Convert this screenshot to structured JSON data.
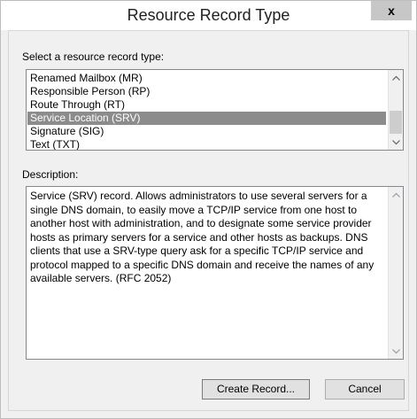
{
  "window": {
    "title": "Resource Record Type",
    "close_glyph": "x"
  },
  "record_list": {
    "label": "Select a resource record type:",
    "items": [
      {
        "label": "Renamed Mailbox (MR)",
        "selected": false
      },
      {
        "label": "Responsible Person (RP)",
        "selected": false
      },
      {
        "label": "Route Through (RT)",
        "selected": false
      },
      {
        "label": "Service Location (SRV)",
        "selected": true
      },
      {
        "label": "Signature (SIG)",
        "selected": false
      },
      {
        "label": "Text (TXT)",
        "selected": false
      }
    ],
    "scroll_up_icon": "chevron-up-icon",
    "scroll_down_icon": "chevron-down-icon"
  },
  "description": {
    "label": "Description:",
    "text": "Service (SRV) record. Allows administrators to use several servers for a single DNS domain, to easily move a TCP/IP service from one host to another host with administration, and to designate some service provider hosts as primary servers for a service and other hosts as backups. DNS clients that use a SRV-type query ask for a specific TCP/IP service and protocol mapped to a specific DNS domain and receive the names of any available servers. (RFC 2052)"
  },
  "buttons": {
    "create_record": "Create Record...",
    "cancel": "Cancel"
  },
  "colors": {
    "selection": "#8c8c8c",
    "window_bg": "#f0f0f0",
    "close_bg": "#c7c7c7"
  }
}
